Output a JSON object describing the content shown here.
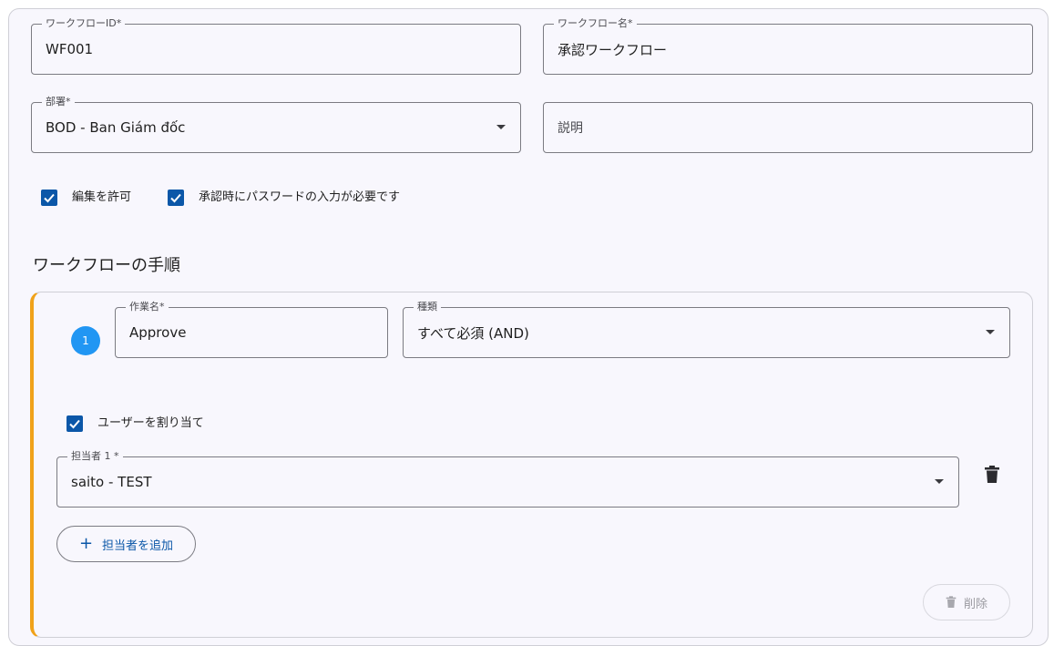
{
  "form": {
    "workflow_id": {
      "label": "ワークフローID*",
      "value": "WF001"
    },
    "workflow_name": {
      "label": "ワークフロー名*",
      "value": "承認ワークフロー"
    },
    "department": {
      "label": "部署*",
      "value": "BOD - Ban Giám đốc"
    },
    "description": {
      "placeholder": "説明"
    },
    "allow_edit": {
      "label": "編集を許可",
      "checked": true
    },
    "require_password": {
      "label": "承認時にパスワードの入力が必要です",
      "checked": true
    }
  },
  "steps_section": {
    "title": "ワークフローの手順"
  },
  "step": {
    "number": "1",
    "task_name": {
      "label": "作業名*",
      "value": "Approve"
    },
    "type": {
      "label": "種類",
      "value": "すべて必須 (AND)"
    },
    "assign_users": {
      "label": "ユーザーを割り当て",
      "checked": true
    },
    "assignee": {
      "label": "担当者 1 *",
      "value": "saito - TEST"
    },
    "add_assignee_label": "担当者を追加",
    "delete_label": "削除"
  },
  "colors": {
    "accent": "#0b57a8",
    "step_badge": "#2196f3",
    "step_border": "#f0a21a"
  }
}
